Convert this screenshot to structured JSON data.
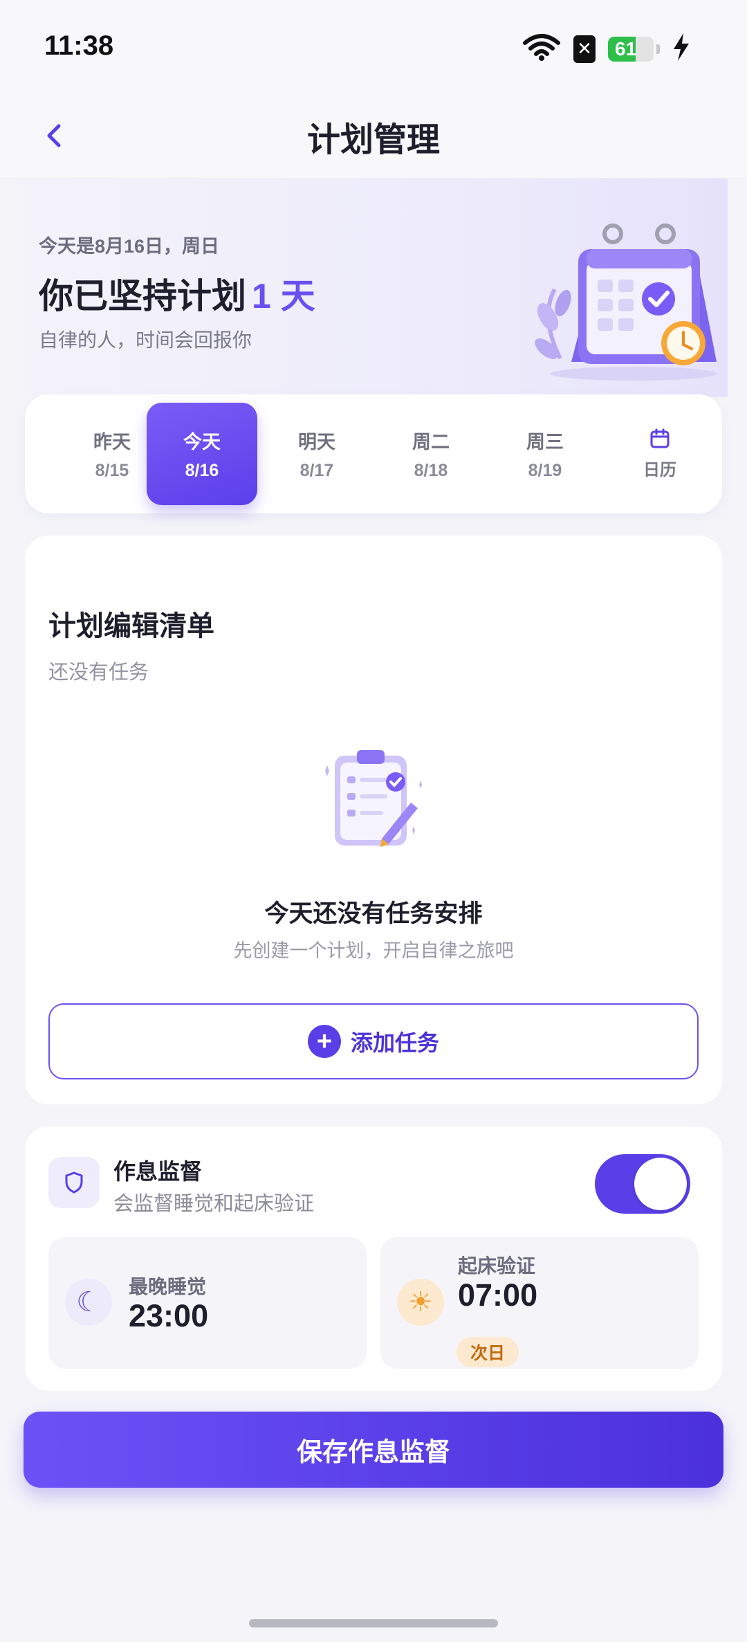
{
  "status_bar": {
    "time": "11:38",
    "battery_level": "61",
    "battery_fraction": 0.61,
    "icons": [
      "wifi-icon",
      "sim-off-icon",
      "battery-icon",
      "charging-icon"
    ]
  },
  "nav": {
    "title": "计划管理",
    "back_icon": "chevron-left-icon"
  },
  "hero": {
    "date_text": "今天是8月16日，周日",
    "title_prefix": "你已坚持计划",
    "title_count": "1 天",
    "subtitle": "自律的人，时间会回报你"
  },
  "date_tabs": [
    {
      "label": "昨天",
      "date": "8/15"
    },
    {
      "label": "今天",
      "date": "8/16",
      "active": true
    },
    {
      "label": "明天",
      "date": "8/17"
    },
    {
      "label": "周二",
      "date": "8/18"
    },
    {
      "label": "周三",
      "date": "8/19"
    }
  ],
  "calendar_tab": {
    "label": "日历",
    "icon": "calendar-icon"
  },
  "plan": {
    "title": "计划编辑清单",
    "subtitle": "还没有任务",
    "empty_title": "今天还没有任务安排",
    "empty_subtitle": "先创建一个计划，开启自律之旅吧",
    "add_label": "添加任务",
    "add_icon": "+"
  },
  "sleep": {
    "title": "作息监督",
    "subtitle": "会监督睡觉和起床验证",
    "enabled": true,
    "bedtime_label": "最晚睡觉",
    "bedtime": "23:00",
    "wake_label": "起床验证",
    "wake_time": "07:00",
    "next_day": "次日",
    "moon_icon": "☾",
    "sun_icon": "☀"
  },
  "save_label": "保存作息监督",
  "colors": {
    "accent": "#5a3fe8",
    "accent_light": "#efedfc",
    "background": "#f4f4f9",
    "battery": "#2dbf4a"
  }
}
